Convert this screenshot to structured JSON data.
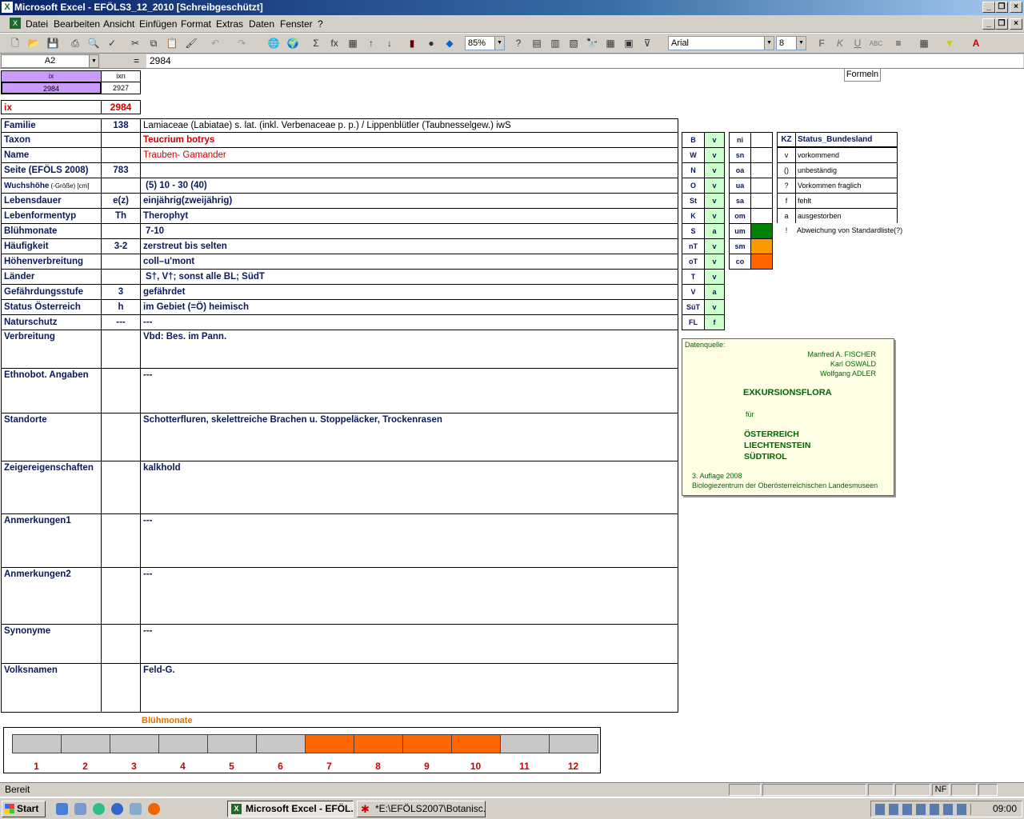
{
  "window": {
    "title": "Microsoft Excel - EFÖLS3_12_2010  [Schreibgeschützt]"
  },
  "menu": [
    "Datei",
    "Bearbeiten",
    "Ansicht",
    "Einfügen",
    "Format",
    "Extras",
    "Daten",
    "Fenster",
    "?"
  ],
  "toolbar": {
    "zoom": "85%",
    "font": "Arial",
    "size": "8"
  },
  "formula": {
    "cell": "A2",
    "eq": "=",
    "value": "2984"
  },
  "formeln_label": "Formeln",
  "header_cells": {
    "ix_label": "ix",
    "ixn_label": "ixn",
    "ix_val": "2984",
    "ixn_val": "2927"
  },
  "ix_row": {
    "label": "ix",
    "value": "2984"
  },
  "rows": [
    {
      "label": "Familie",
      "num": "138",
      "value": "Lamiaceae (Labiatae) s. lat. (inkl. Verbenaceae p. p.)  /  Lippenblütler (Taubnesselgew.) iwS"
    },
    {
      "label": "Taxon",
      "num": "",
      "value": "Teucrium botrys"
    },
    {
      "label": "Name",
      "num": "",
      "value": "Trauben- Gamander"
    },
    {
      "label": "Seite (EFÖLS 2008)",
      "num": "783",
      "value": ""
    },
    {
      "label": "Wuchshöhe",
      "label_small": "(-Größe) [cm]",
      "num": "",
      "value": "(5) 10 - 30 (40)"
    },
    {
      "label": "Lebensdauer",
      "num": "e(z)",
      "value": "einjährig(zweijährig)"
    },
    {
      "label": "Lebenformentyp",
      "num": "Th",
      "value": "Therophyt"
    },
    {
      "label": "Blühmonate",
      "num": "",
      "value": "7-10"
    },
    {
      "label": "Häufigkeit",
      "num": "3-2",
      "value": "zerstreut bis selten"
    },
    {
      "label": "Höhenverbreitung",
      "num": "",
      "value": "coll–u'mont"
    },
    {
      "label": "Länder",
      "num": "",
      "value": "S†, V†; sonst alle BL; SüdT"
    },
    {
      "label": "Gefährdungsstufe",
      "num": "3",
      "value": "gefährdet"
    },
    {
      "label": "Status Österreich",
      "num": "h",
      "value": "im Gebiet (=Ö) heimisch"
    },
    {
      "label": "Naturschutz",
      "num": "---",
      "value": "---"
    },
    {
      "label": "Verbreitung",
      "num": "",
      "value": "Vbd: Bes. im Pann."
    },
    {
      "label": "Ethnobot. Angaben",
      "num": "",
      "value": "---"
    },
    {
      "label": "Standorte",
      "num": "",
      "value": "Schotterfluren, skelettreiche Brachen u. Stoppeläcker, Trockenrasen"
    },
    {
      "label": "Zeigereigenschaften",
      "num": "",
      "value": "kalkhold"
    },
    {
      "label": "Anmerkungen1",
      "num": "",
      "value": "---"
    },
    {
      "label": "Anmerkungen2",
      "num": "",
      "value": "---"
    },
    {
      "label": "Synonyme",
      "num": "",
      "value": "---"
    },
    {
      "label": "Volksnamen",
      "num": "",
      "value": "Feld-G."
    }
  ],
  "states": [
    {
      "k": "B",
      "v": "v"
    },
    {
      "k": "W",
      "v": "v"
    },
    {
      "k": "N",
      "v": "v"
    },
    {
      "k": "O",
      "v": "v"
    },
    {
      "k": "St",
      "v": "v"
    },
    {
      "k": "K",
      "v": "v"
    },
    {
      "k": "S",
      "v": "a"
    },
    {
      "k": "nT",
      "v": "v"
    },
    {
      "k": "oT",
      "v": "v"
    },
    {
      "k": "T",
      "v": "v"
    },
    {
      "k": "V",
      "v": "a"
    },
    {
      "k": "SüT",
      "v": "v"
    },
    {
      "k": "FL",
      "v": "f"
    }
  ],
  "zones": [
    {
      "k": "ni",
      "color": ""
    },
    {
      "k": "sn",
      "color": ""
    },
    {
      "k": "oa",
      "color": ""
    },
    {
      "k": "ua",
      "color": ""
    },
    {
      "k": "sa",
      "color": ""
    },
    {
      "k": "om",
      "color": ""
    },
    {
      "k": "um",
      "color": "#008000"
    },
    {
      "k": "sm",
      "color": "#ff9900"
    },
    {
      "k": "co",
      "color": "#ff6600"
    }
  ],
  "legend": {
    "header_kz": "KZ",
    "header_status": "Status_Bundesland",
    "items": [
      {
        "k": "v",
        "t": "vorkommend"
      },
      {
        "k": "()",
        "t": "unbeständig"
      },
      {
        "k": "?",
        "t": "Vorkommen fraglich"
      },
      {
        "k": "f",
        "t": "fehlt"
      },
      {
        "k": "a",
        "t": "ausgestorben"
      },
      {
        "k": "!",
        "t": "Abweichung von Standardliste(?)"
      }
    ]
  },
  "source": {
    "label": "Datenquelle:",
    "authors": [
      "Manfred A. FISCHER",
      "Karl OSWALD",
      "Wolfgang ADLER"
    ],
    "title": "EXKURSIONSFLORA",
    "fuer": "für",
    "countries": [
      "ÖSTERREICH",
      "LIECHTENSTEIN",
      "SÜDTIROL"
    ],
    "edition": "3. Auflage 2008",
    "publisher": "Biologiezentrum der Oberösterreichischen Landesmuseen"
  },
  "bloom": {
    "title": "Blühmonate",
    "months": [
      "1",
      "2",
      "3",
      "4",
      "5",
      "6",
      "7",
      "8",
      "9",
      "10",
      "11",
      "12"
    ],
    "active": [
      false,
      false,
      false,
      false,
      false,
      false,
      true,
      true,
      true,
      true,
      false,
      false
    ],
    "active_color": "#ff6600",
    "inactive_color": "#c8c8c8"
  },
  "status": {
    "text": "Bereit",
    "nf": "NF"
  },
  "taskbar": {
    "start": "Start",
    "tasks": [
      "Microsoft Excel - EFÖL...",
      "*E:\\EFÖLS2007\\Botanisc..."
    ],
    "clock": "09:00"
  }
}
